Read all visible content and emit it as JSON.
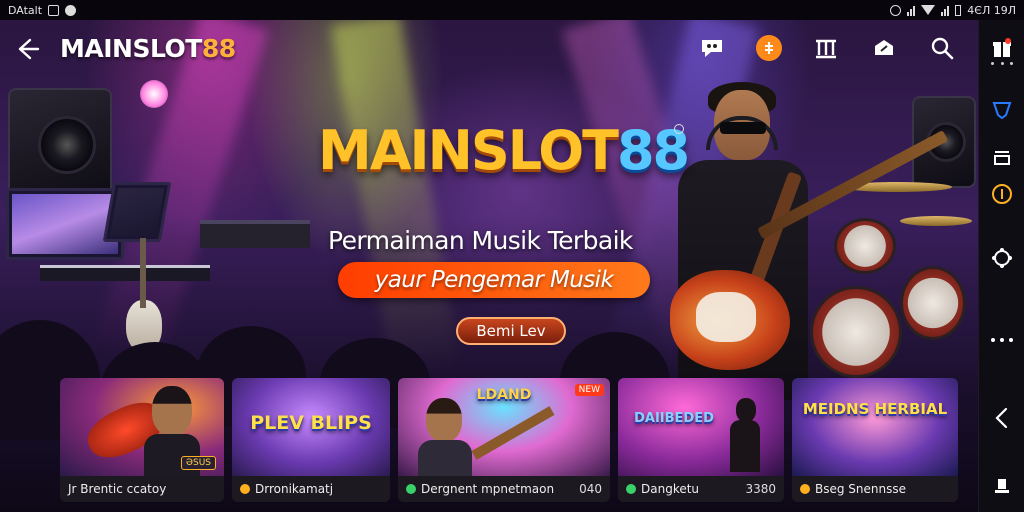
{
  "statusbar": {
    "left_text": "DAtalt",
    "right_text": "4ЄЛ 19Л"
  },
  "header": {
    "brand_main": "MAINSLOT",
    "brand_accent": "88",
    "icons": [
      "chat-icon",
      "promo-icon",
      "bank-icon",
      "share-icon",
      "search-icon"
    ]
  },
  "hero": {
    "logo_main": "MAINSLOT",
    "logo_accent": "88",
    "tagline_1": "Permaiman Musik Terbaik",
    "tagline_2": "yaur Pengemar Musik",
    "cta_label": "Bemi Lev"
  },
  "cards": [
    {
      "label": "Jr Brentic ccatoy",
      "number": "",
      "art_title": "",
      "tag": "ƏSUS",
      "badge": ""
    },
    {
      "label": "Drronikamatj",
      "number": "",
      "art_title": "PLEV BLIPS",
      "tag": "",
      "badge": ""
    },
    {
      "label": "Dergnent mpnetmaon",
      "number": "040",
      "art_title": "LDAND",
      "tag": "",
      "badge": "NEW"
    },
    {
      "label": "Dangketu",
      "number": "3380",
      "art_title": "DAIIBEDED",
      "tag": "",
      "badge": ""
    },
    {
      "label": "Bseg Snennsse",
      "number": "",
      "art_title": "MEIDNS HERBIAL",
      "tag": "",
      "badge": ""
    }
  ],
  "colors": {
    "accent_orange": "#ff8a1a",
    "logo_gold": "#ffc229",
    "logo_blue": "#57c8ff",
    "cta_red": "#c8461e"
  }
}
